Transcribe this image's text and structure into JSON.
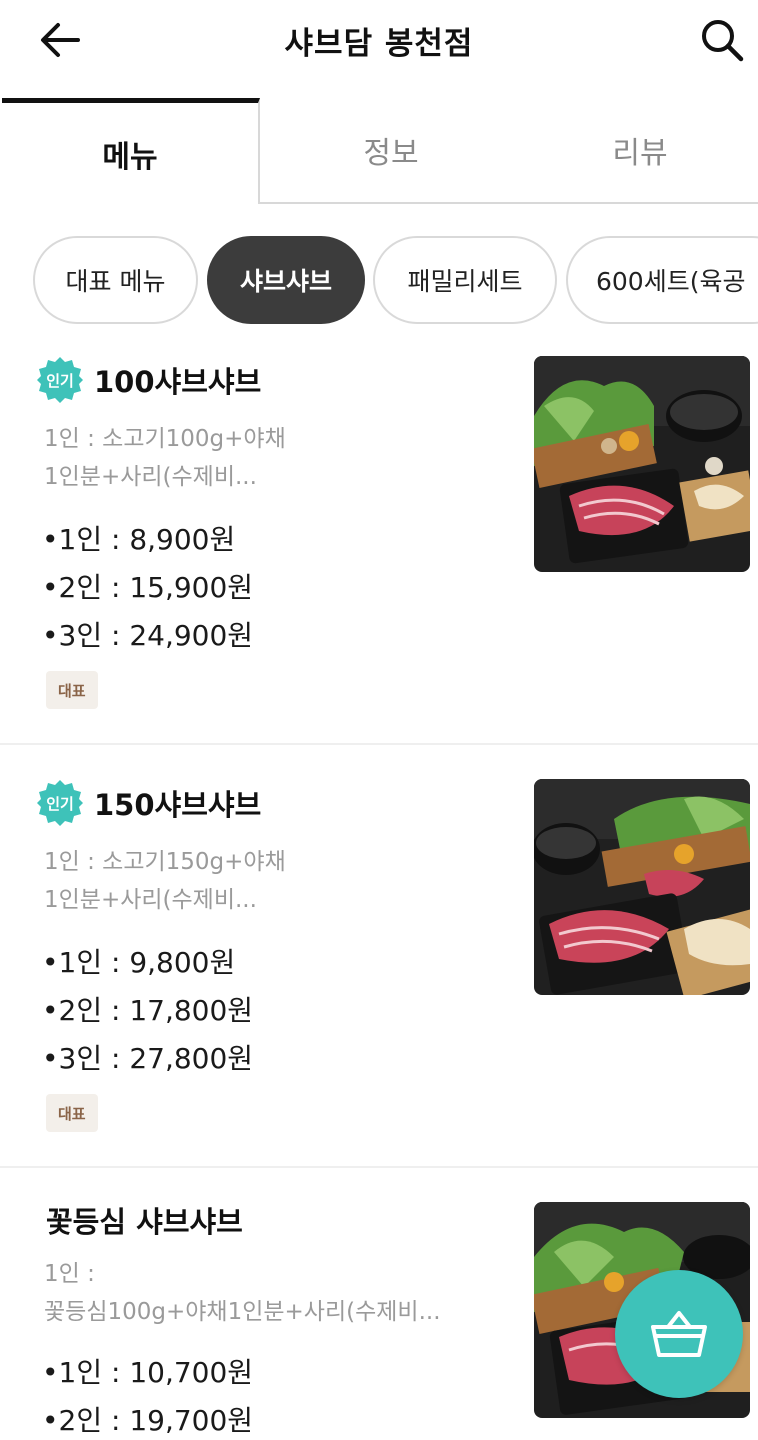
{
  "header": {
    "title": "샤브담 봉천점",
    "back_icon": "arrow-left-icon",
    "search_icon": "search-icon"
  },
  "tabs": [
    {
      "label": "메뉴",
      "active": true
    },
    {
      "label": "정보",
      "active": false
    },
    {
      "label": "리뷰",
      "active": false
    }
  ],
  "categories": [
    {
      "label": "대표 메뉴",
      "active": false
    },
    {
      "label": "샤브샤브",
      "active": true
    },
    {
      "label": "패밀리세트",
      "active": false
    },
    {
      "label": "600세트(육공",
      "active": false
    }
  ],
  "items": [
    {
      "badge": "인기",
      "name": "100샤브샤브",
      "desc_line1": "1인 : 소고기100g+야채",
      "desc_line2": "1인분+사리(수제비...",
      "prices": [
        "•1인 : 8,900원",
        "•2인 : 15,900원",
        "•3인 : 24,900원"
      ],
      "tag": "대표"
    },
    {
      "badge": "인기",
      "name": "150샤브샤브",
      "desc_line1": "1인 : 소고기150g+야채",
      "desc_line2": "1인분+사리(수제비...",
      "prices": [
        "•1인 : 9,800원",
        "•2인 : 17,800원",
        "•3인 : 27,800원"
      ],
      "tag": "대표"
    },
    {
      "name": "꽃등심 샤브샤브",
      "desc_line1": "1인 :",
      "desc_line2": "꽃등심100g+야채1인분+사리(수제비...",
      "prices": [
        "•1인 : 10,700원",
        "•2인 : 19,700원"
      ]
    }
  ],
  "colors": {
    "accent": "#3ec2b9",
    "active_chip": "#3c3c3c",
    "tag_bg": "#f3efea",
    "tag_text": "#8a6448"
  },
  "cart_icon": "shopping-basket-icon"
}
